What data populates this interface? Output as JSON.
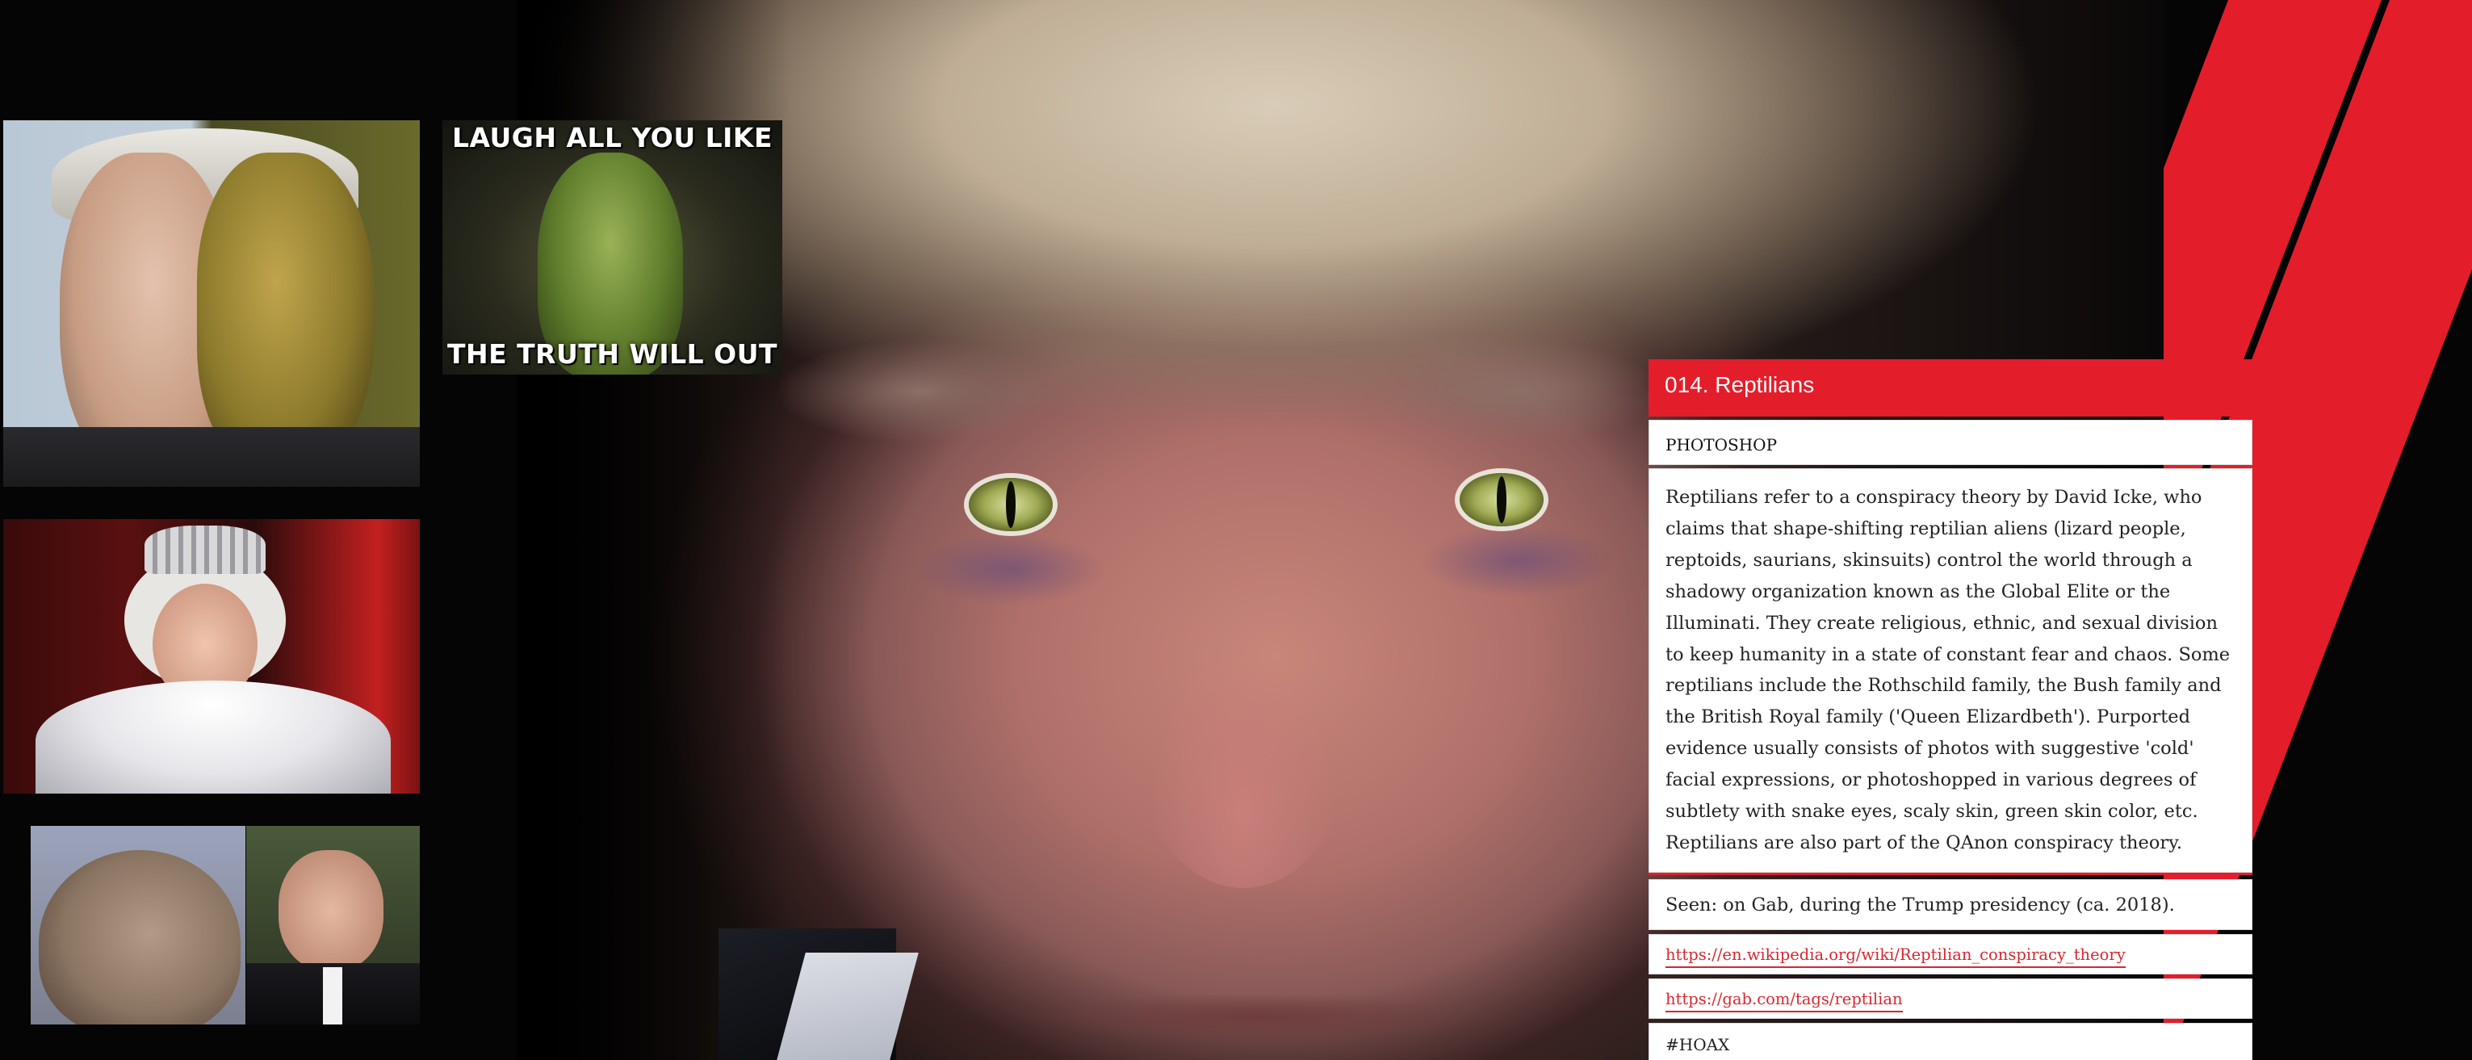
{
  "thumbnails": {
    "meme": {
      "top_text": "LAUGH ALL YOU LIKE",
      "bottom_text": "THE TRUTH WILL OUT"
    }
  },
  "panel": {
    "title": "014. Reptilians",
    "category": "PHOTOSHOP",
    "description": "Reptilians refer to a conspiracy theory by David Icke, who claims that shape-shifting reptilian aliens (lizard people, reptoids, saurians, skinsuits) control the world through a shadowy organization known as the Global Elite or the Illuminati. They create religious, ethnic, and sexual division to keep humanity in a state of constant fear and chaos. Some reptilians include the Rothschild family, the Bush family and the British Royal family ('Queen Elizardbeth'). Purported evidence usually consists of photos with suggestive 'cold' facial expressions, or photoshopped in various degrees of subtlety with snake eyes, scaly skin, green skin color, etc. Reptilians are also part of the QAnon conspiracy theory.",
    "seen": "Seen: on Gab, during the Trump presidency (ca. 2018).",
    "links": [
      "https://en.wikipedia.org/wiki/Reptilian_conspiracy_theory",
      "https://gab.com/tags/reptilian"
    ],
    "hashtag": "#HOAX"
  },
  "colors": {
    "accent": "#e41d2b",
    "background": "#000000",
    "panel": "#ffffff"
  }
}
